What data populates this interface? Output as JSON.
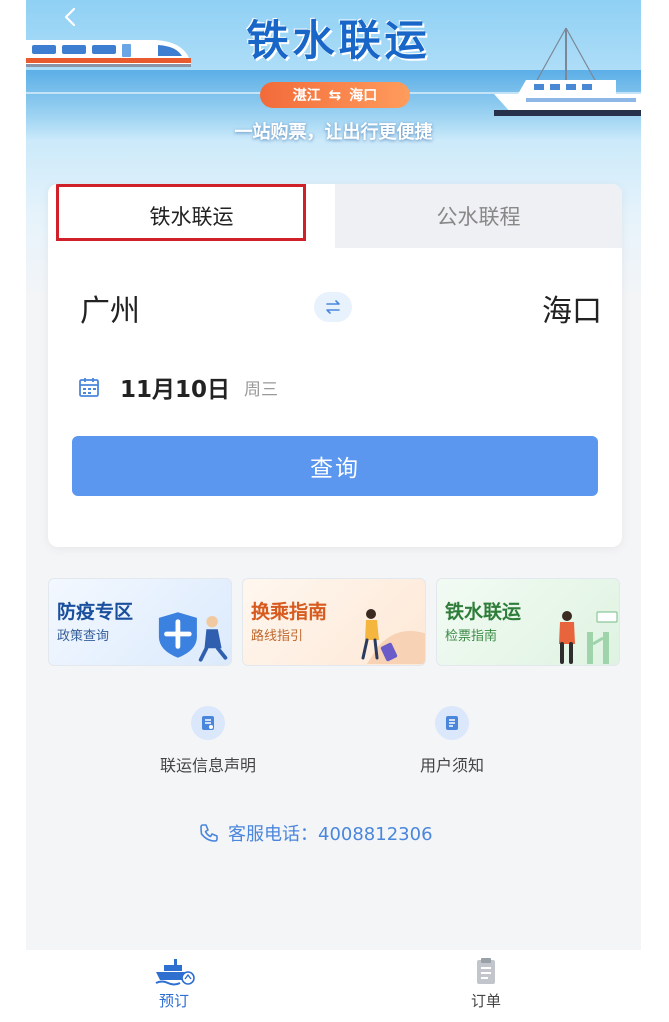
{
  "header": {
    "title": "铁水联运",
    "route_from": "湛江",
    "route_swap_icon": "swap-arrows-icon",
    "route_to": "海口",
    "slogan": "一站购票，让出行更便捷"
  },
  "booking": {
    "tabs": [
      {
        "label": "铁水联运",
        "active": true
      },
      {
        "label": "公水联程",
        "active": false
      }
    ],
    "from_city": "广州",
    "to_city": "海口",
    "date": "11月10日",
    "weekday": "周三",
    "search_label": "查询"
  },
  "guides": [
    {
      "title": "防疫专区",
      "subtitle": "政策查询"
    },
    {
      "title": "换乘指南",
      "subtitle": "路线指引"
    },
    {
      "title": "铁水联运",
      "subtitle": "检票指南"
    }
  ],
  "info_links": [
    {
      "label": "联运信息声明"
    },
    {
      "label": "用户须知"
    }
  ],
  "service": {
    "text": "客服电话：4008812306"
  },
  "nav": [
    {
      "label": "预订",
      "active": true
    },
    {
      "label": "订单",
      "active": false
    }
  ],
  "colors": {
    "primary": "#5b97ee",
    "title_blue": "#1766c8",
    "route_orange": "#f26b3a",
    "highlight_red": "#d0202a",
    "link_blue": "#4a86dc"
  }
}
